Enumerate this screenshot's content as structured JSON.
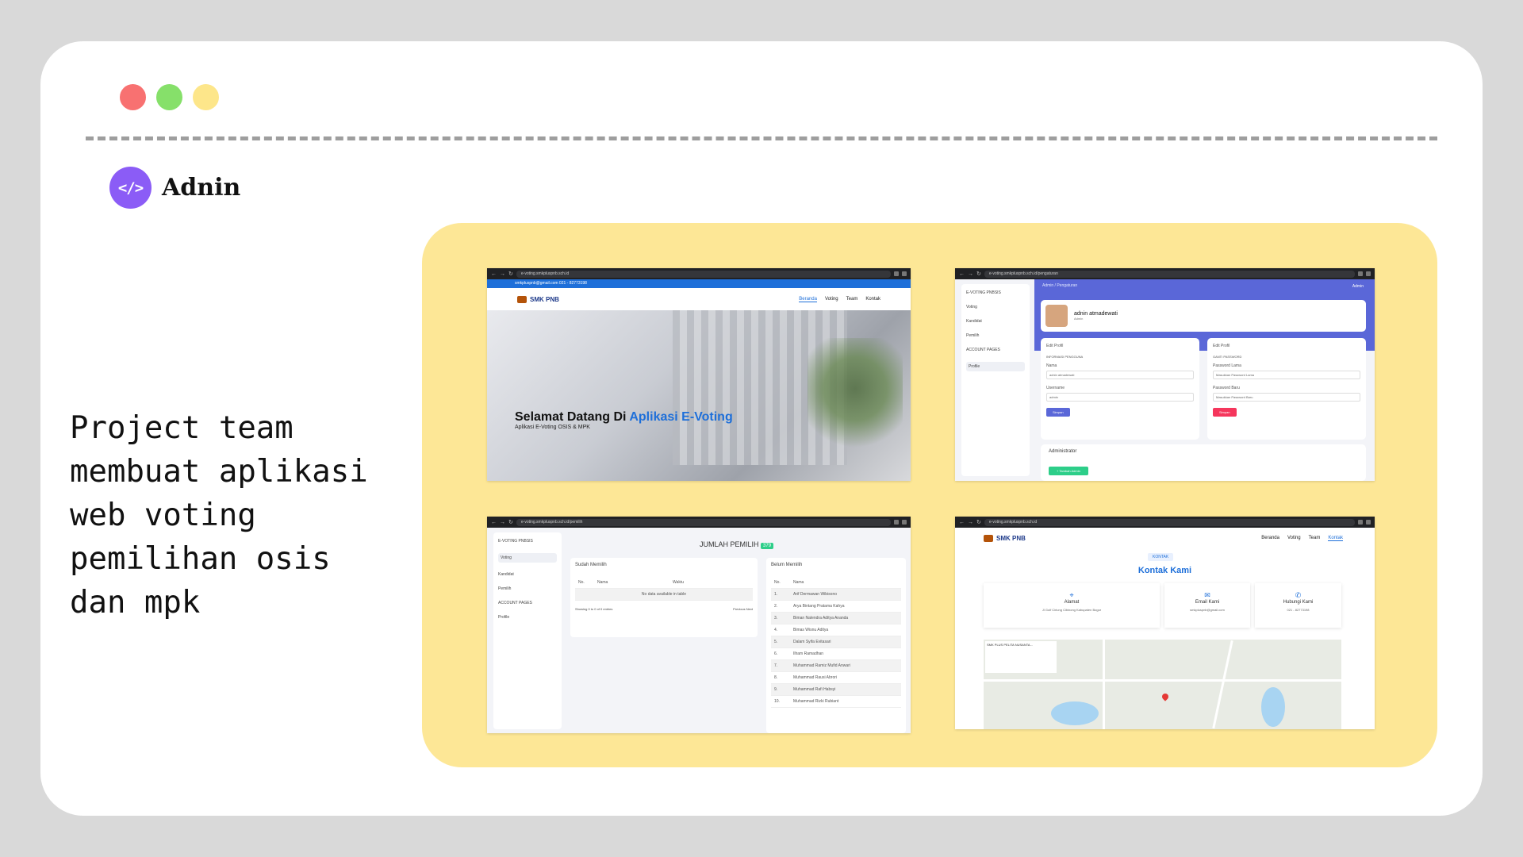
{
  "window": {
    "dots": [
      {
        "name": "close",
        "color": "#f87171"
      },
      {
        "name": "minimize",
        "color": "#86e06a"
      },
      {
        "name": "maximize",
        "color": "#fde68a"
      }
    ]
  },
  "brand": {
    "icon_label": "</>",
    "name": "Adnin",
    "icon_color": "#8b5cf6"
  },
  "description": "Project team\nmembuat aplikasi\nweb voting\npemilihan osis\ndan mpk",
  "gallery_color": "#fde796",
  "shots": {
    "home": {
      "url": "e-voting.smkpluspnb.sch.id",
      "topbar": "smkpluspnb@gmail.com   021 - 82773198",
      "logo": "SMK PNB",
      "menu": [
        "Beranda",
        "Voting",
        "Team",
        "Kontak"
      ],
      "title_plain": "Selamat Datang Di ",
      "title_highlight": "Aplikasi E-Voting",
      "subtitle": "Aplikasi E-Voting OSIS & MPK"
    },
    "settings": {
      "url": "e-voting.smkpluspnb.sch.id/pengaturan",
      "sidebar_title": "E-VOTING PNBSIS",
      "sidebar_items": [
        "Voting",
        "Kandidat",
        "Pemilih",
        "ACCOUNT PAGES",
        "Profile"
      ],
      "breadcrumb": "Admin / Pengaturan",
      "user": "Admin",
      "profile_name": "adnin atmadewati",
      "profile_role": "Admin",
      "edit_profile": {
        "title": "Edit Profil",
        "section": "INFORMASI PENGGUNA",
        "name_label": "Nama",
        "name_value": "adnin atmadewati",
        "username_label": "Username",
        "username_value": "admin",
        "button": "Simpan"
      },
      "password": {
        "title": "Edit Profil",
        "section": "GANTI PASSWORD",
        "old_label": "Password Lama",
        "old_placeholder": "Masukkan Password Lama",
        "new_label": "Password Baru",
        "new_placeholder": "Masukkan Password Baru",
        "button": "Simpan"
      },
      "admin_title": "Administrator",
      "admin_button": "+ Tambah Admin"
    },
    "voters": {
      "url": "e-voting.smkpluspnb.sch.id/pemilih",
      "sidebar_title": "E-VOTING PNBSIS",
      "sidebar_items": [
        "Voting",
        "Kandidat",
        "Pemilih",
        "ACCOUNT PAGES",
        "Profile"
      ],
      "title": "JUMLAH PEMILIH",
      "count": "379",
      "voted_title": "Sudah Memilih",
      "voted_cols": [
        "No.",
        "Nama",
        "Waktu"
      ],
      "voted_empty": "No data available in table",
      "voted_footer": "Showing 0 to 0 of 0 entries",
      "voted_paging": "Previous Next",
      "not_voted_title": "Belum Memilih",
      "not_voted_cols": [
        "No.",
        "Nama"
      ],
      "not_voted_rows": [
        {
          "no": "1.",
          "name": "Arif Dermawan Wibisono"
        },
        {
          "no": "2.",
          "name": "Arya Bintang Pratama Kahya"
        },
        {
          "no": "3.",
          "name": "Biman Nalendra Aditya Ananda"
        },
        {
          "no": "4.",
          "name": "Bimas Wisnu Aditya"
        },
        {
          "no": "5.",
          "name": "Dalam Syifa Evitasari"
        },
        {
          "no": "6.",
          "name": "Ilham Ramadhan"
        },
        {
          "no": "7.",
          "name": "Muhammad Ramiz Mufid Anwari"
        },
        {
          "no": "8.",
          "name": "Muhammad Rausi Abrori"
        },
        {
          "no": "9.",
          "name": "Muhammad Rafi Habsyi"
        },
        {
          "no": "10.",
          "name": "Muhammad Rizki Rubiant"
        }
      ]
    },
    "contact": {
      "url": "e-voting.smkpluspnb.sch.id",
      "logo": "SMK PNB",
      "menu": [
        "Beranda",
        "Voting",
        "Team",
        "Kontak"
      ],
      "tag": "KONTAK",
      "title": "Kontak Kami",
      "cards": [
        {
          "icon": "location-icon",
          "glyph": "⌖",
          "title": "Alamat",
          "text": "Jl Golf Ciriung Cibinong Kabupaten Bogor"
        },
        {
          "icon": "mail-icon",
          "glyph": "✉",
          "title": "Email Kami",
          "text": "smkpluspnb@gmail.com"
        },
        {
          "icon": "phone-icon",
          "glyph": "✆",
          "title": "Hubungi Kami",
          "text": "021 - 82773198"
        }
      ],
      "map_label": "SMK PLUS PELITA NUSANTA..."
    }
  }
}
